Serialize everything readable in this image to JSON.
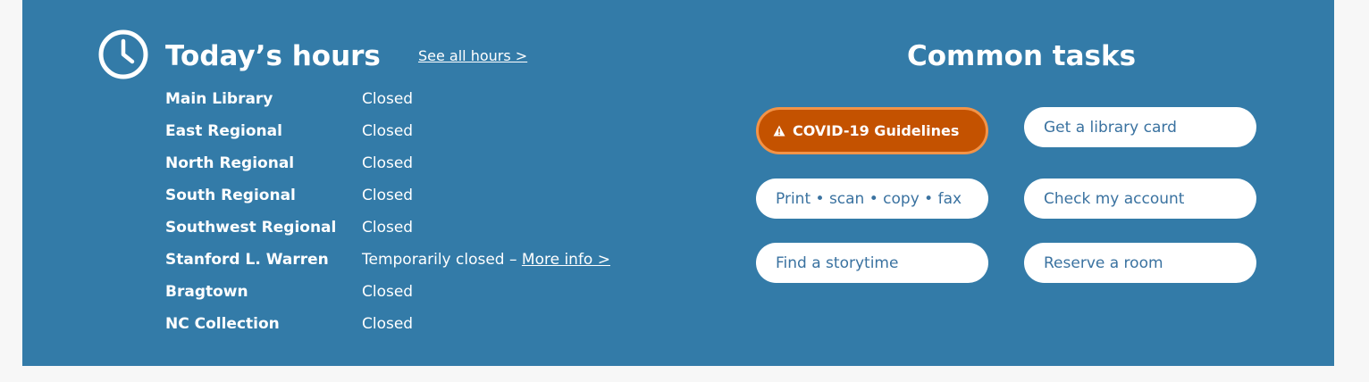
{
  "hours": {
    "title": "Today’s hours",
    "see_all_link": "See all hours >",
    "locations": [
      {
        "name": "Main Library",
        "status": "Closed",
        "link": ""
      },
      {
        "name": "East Regional",
        "status": "Closed",
        "link": ""
      },
      {
        "name": "North Regional",
        "status": "Closed",
        "link": ""
      },
      {
        "name": "South Regional",
        "status": "Closed",
        "link": ""
      },
      {
        "name": "Southwest Regional",
        "status": "Closed",
        "link": ""
      },
      {
        "name": "Stanford L. Warren",
        "status": "Temporarily closed – ",
        "link": "More info >"
      },
      {
        "name": "Bragtown",
        "status": "Closed",
        "link": ""
      },
      {
        "name": "NC Collection",
        "status": "Closed",
        "link": ""
      }
    ]
  },
  "tasks": {
    "title": "Common tasks",
    "covid_label": "COVID-19 Guidelines",
    "library_card": "Get a library card",
    "print_scan": "Print • scan • copy • fax",
    "check_account": "Check my account",
    "storytime": "Find a storytime",
    "reserve_room": "Reserve a room"
  },
  "colors": {
    "panel": "#337ba8",
    "covid_button": "#c45200",
    "covid_border": "#f39347",
    "task_text": "#3a72a0"
  },
  "icons": {
    "clock": "clock-icon",
    "warning": "warning-icon"
  }
}
